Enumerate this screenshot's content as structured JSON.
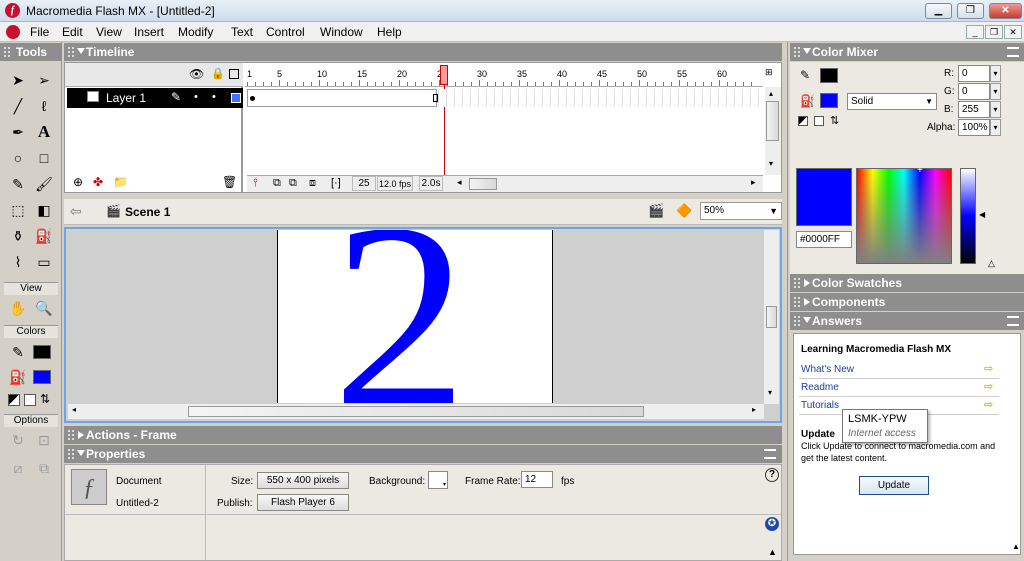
{
  "app": {
    "window_title": "Macromedia Flash MX - [Untitled-2]",
    "menu": [
      "File",
      "Edit",
      "View",
      "Insert",
      "Modify",
      "Text",
      "Control",
      "Window",
      "Help"
    ]
  },
  "tools": {
    "title": "Tools",
    "view_label": "View",
    "colors_label": "Colors",
    "options_label": "Options",
    "stroke_color": "#000000",
    "fill_color": "#0000FF"
  },
  "timeline": {
    "title": "Timeline",
    "layer_name": "Layer 1",
    "ruler_labels": [
      "1",
      "5",
      "10",
      "15",
      "20",
      "25",
      "30",
      "35",
      "40",
      "45",
      "50",
      "55",
      "60"
    ],
    "current_frame": "25",
    "frame_rate": "12.0 fps",
    "elapsed": "2.0s"
  },
  "stage": {
    "scene": "Scene 1",
    "zoom": "50%",
    "content_glyph": "2",
    "content_color": "#0000FF"
  },
  "panels": {
    "actions": "Actions - Frame",
    "properties": "Properties"
  },
  "properties": {
    "doc_type": "Document",
    "doc_name": "Untitled-2",
    "size_label": "Size:",
    "size_value": "550 x 400 pixels",
    "publish_label": "Publish:",
    "publish_value": "Flash Player 6",
    "background_label": "Background:",
    "frame_rate_label": "Frame Rate:",
    "frame_rate_value": "12",
    "fps": "fps"
  },
  "color_mixer": {
    "title": "Color Mixer",
    "r_label": "R:",
    "r": "0",
    "g_label": "G:",
    "g": "0",
    "b_label": "B:",
    "b": "255",
    "alpha_label": "Alpha:",
    "alpha": "100%",
    "fill_type": "Solid",
    "hex": "#0000FF"
  },
  "side_panels": {
    "swatches": "Color Swatches",
    "components": "Components",
    "answers": "Answers"
  },
  "answers": {
    "heading": "Learning Macromedia Flash MX",
    "links": [
      "What's New",
      "Readme",
      "Tutorials"
    ],
    "update_title": "Update",
    "update_text_1": "Click Update to connect to macromedia.com and",
    "update_text_2": "get the latest content.",
    "update_button": "Update",
    "tooltip_title": "LSMK-YPW",
    "tooltip_sub": "Internet access"
  }
}
